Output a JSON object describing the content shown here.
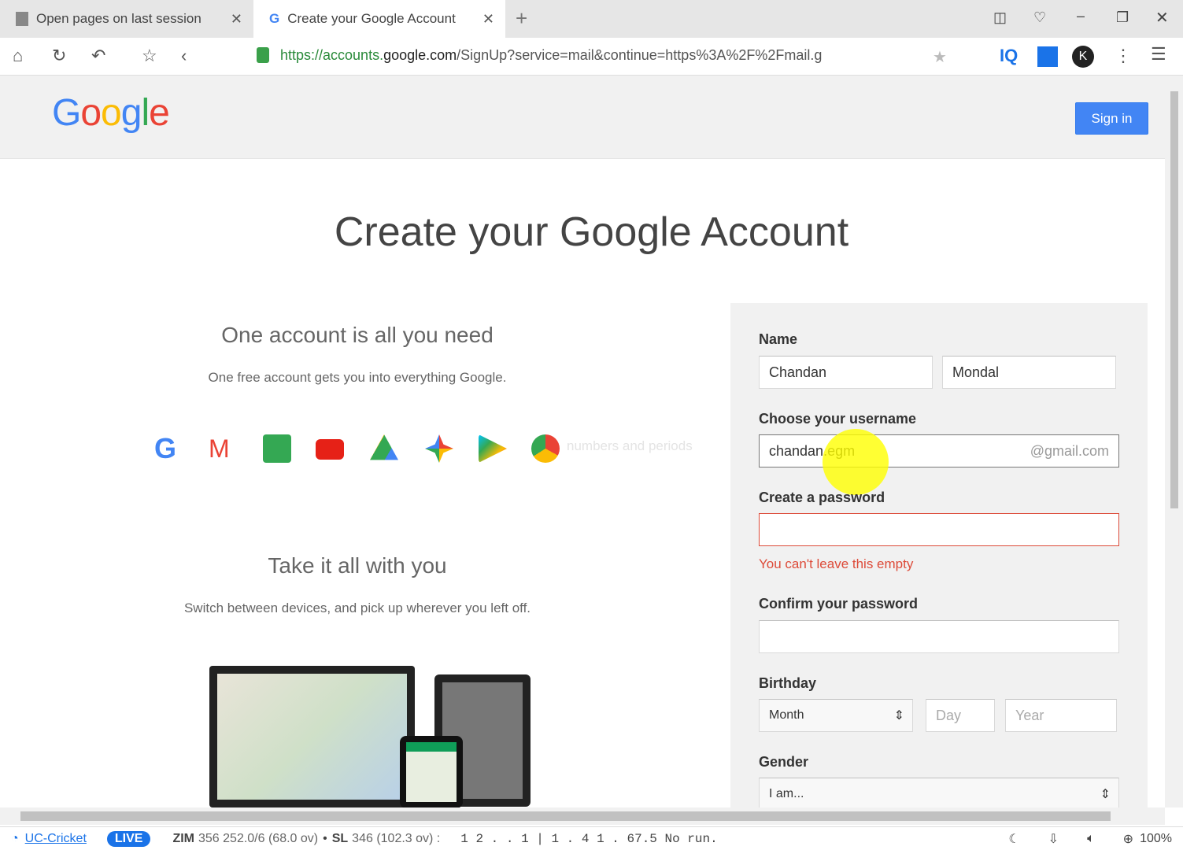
{
  "browser": {
    "tabs": [
      {
        "label": "Open pages on last session"
      },
      {
        "label": "Create your Google Account"
      }
    ],
    "url_prefix": "https://accounts.",
    "url_domain": "google.com",
    "url_rest": "/SignUp?service=mail&continue=https%3A%2F%2Fmail.g",
    "iq_label": "IQ",
    "profile_initial": "K"
  },
  "header": {
    "logo": "Google",
    "signin": "Sign in"
  },
  "main": {
    "title": "Create your Google Account",
    "section1_title": "One account is all you need",
    "section1_text": "One free account gets you into everything Google.",
    "ghost_text": "numbers and periods",
    "section2_title": "Take it all with you",
    "section2_text": "Switch between devices, and pick up wherever you left off."
  },
  "form": {
    "name_label": "Name",
    "first_name": "Chandan",
    "last_name": "Mondal",
    "username_label": "Choose your username",
    "username": "chandan.egm",
    "username_suffix": "@gmail.com",
    "password_label": "Create a password",
    "password_error": "You can't leave this empty",
    "confirm_label": "Confirm your password",
    "birthday_label": "Birthday",
    "month": "Month",
    "day_placeholder": "Day",
    "year_placeholder": "Year",
    "gender_label": "Gender",
    "gender": "I am..."
  },
  "statusbar": {
    "app": "UC-Cricket",
    "live": "LIVE",
    "score1_team": "ZIM",
    "score1": "356 252.0/6 (68.0 ov)",
    "score2_team": "SL",
    "score2": "346 (102.3 ov) :",
    "ticker": "1 2 . . 1 | 1 . 4 1 . 67.5 No run.",
    "zoom": "100%"
  }
}
